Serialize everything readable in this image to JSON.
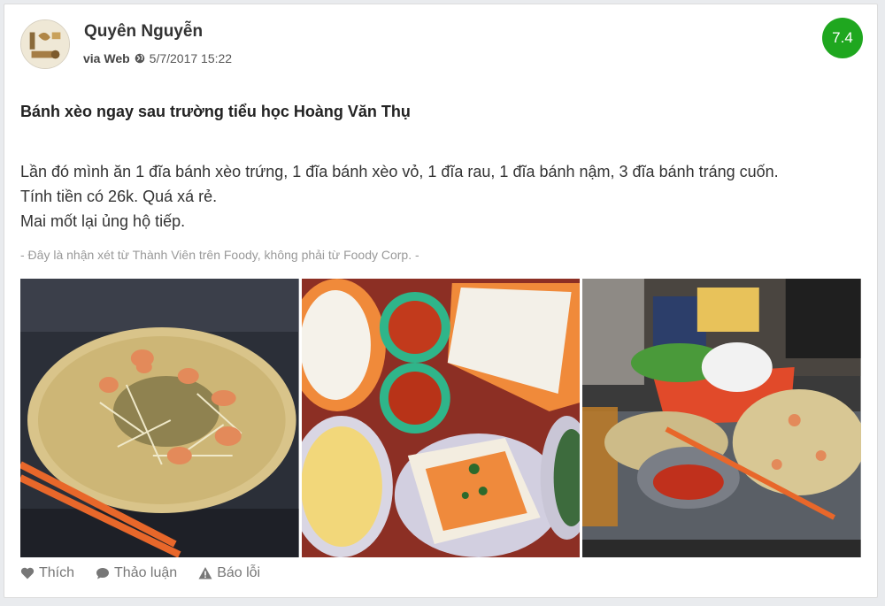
{
  "review": {
    "user_name": "Quyên Nguyễn",
    "via": "via Web",
    "timestamp": "5/7/2017 15:22",
    "score": "7.4",
    "title": "Bánh xèo ngay sau trường tiểu học Hoàng Văn Thụ",
    "body_lines": [
      "Lần đó mình ăn 1 đĩa bánh xèo trứng, 1 đĩa bánh xèo vỏ, 1 đĩa rau, 1 đĩa bánh nậm, 3 đĩa bánh tráng cuốn.",
      "Tính tiền có 26k. Quá xá rẻ.",
      "Mai mốt lại ủng hộ tiếp."
    ],
    "disclaimer": "- Đây là nhận xét từ Thành Viên trên Foody, không phải từ Foody Corp. -"
  },
  "actions": {
    "like": "Thích",
    "discuss": "Thảo luận",
    "report": "Báo lỗi"
  },
  "colors": {
    "score_badge": "#1fa71f",
    "chopsticks": "#e8672a",
    "pancake": "#d9c48a"
  },
  "icons": [
    "globe-icon",
    "heart-icon",
    "comment-icon",
    "warning-icon"
  ]
}
